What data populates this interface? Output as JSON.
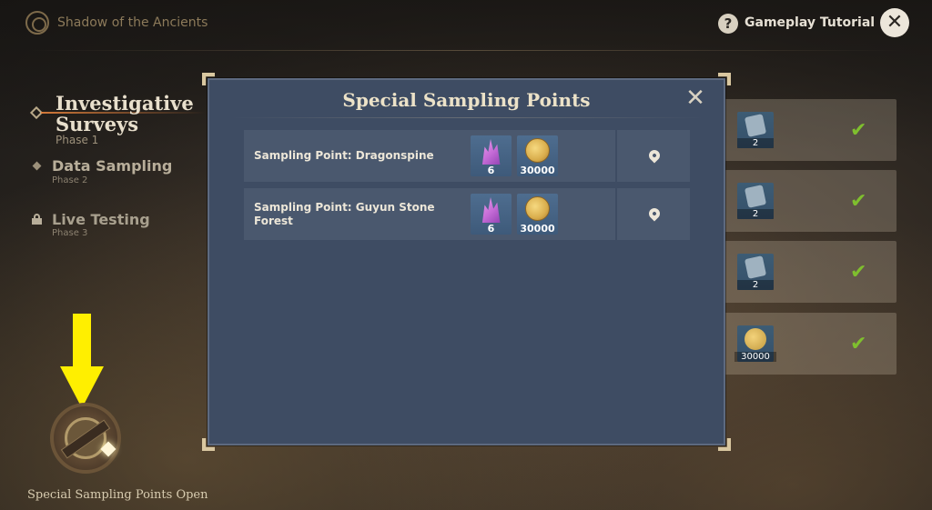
{
  "header": {
    "title": "Shadow of the Ancients",
    "help_label": "Gameplay Tutorial",
    "logo_icon": "event-emblem-icon",
    "help_icon": "question-icon",
    "close_icon": "close-icon"
  },
  "phases": [
    {
      "title": "Investigative Surveys",
      "subtitle": "Phase 1",
      "state": "active"
    },
    {
      "title": "Data Sampling",
      "subtitle": "Phase 2",
      "state": "available"
    },
    {
      "title": "Live Testing",
      "subtitle": "Phase 3",
      "state": "locked"
    }
  ],
  "special_button": {
    "label": "Special Sampling Points Open",
    "icon": "compass-device-icon"
  },
  "background_rewards": [
    {
      "icon": "crystal-chunk-icon",
      "qty": "2",
      "completed": true
    },
    {
      "icon": "crystal-chunk-icon",
      "qty": "2",
      "completed": true
    },
    {
      "icon": "crystal-chunk-icon",
      "qty": "2",
      "completed": true
    },
    {
      "icon": "mora-coin-icon",
      "qty": "30000",
      "completed": true
    }
  ],
  "modal": {
    "title": "Special Sampling Points",
    "close_icon": "close-icon",
    "rows": [
      {
        "name": "Sampling Point: Dragonspine",
        "rewards": [
          {
            "icon": "crystal-icon",
            "qty": "6"
          },
          {
            "icon": "mora-coin-icon",
            "qty": "30000"
          }
        ],
        "action_icon": "location-pin-icon"
      },
      {
        "name": "Sampling Point: Guyun Stone Forest",
        "rewards": [
          {
            "icon": "crystal-icon",
            "qty": "6"
          },
          {
            "icon": "mora-coin-icon",
            "qty": "30000"
          }
        ],
        "action_icon": "location-pin-icon"
      }
    ]
  },
  "colors": {
    "modal_bg": "#3e4c63",
    "row_bg": "#4a586e",
    "check_green": "#7fbf2e",
    "arrow_yellow": "#ffef00"
  }
}
